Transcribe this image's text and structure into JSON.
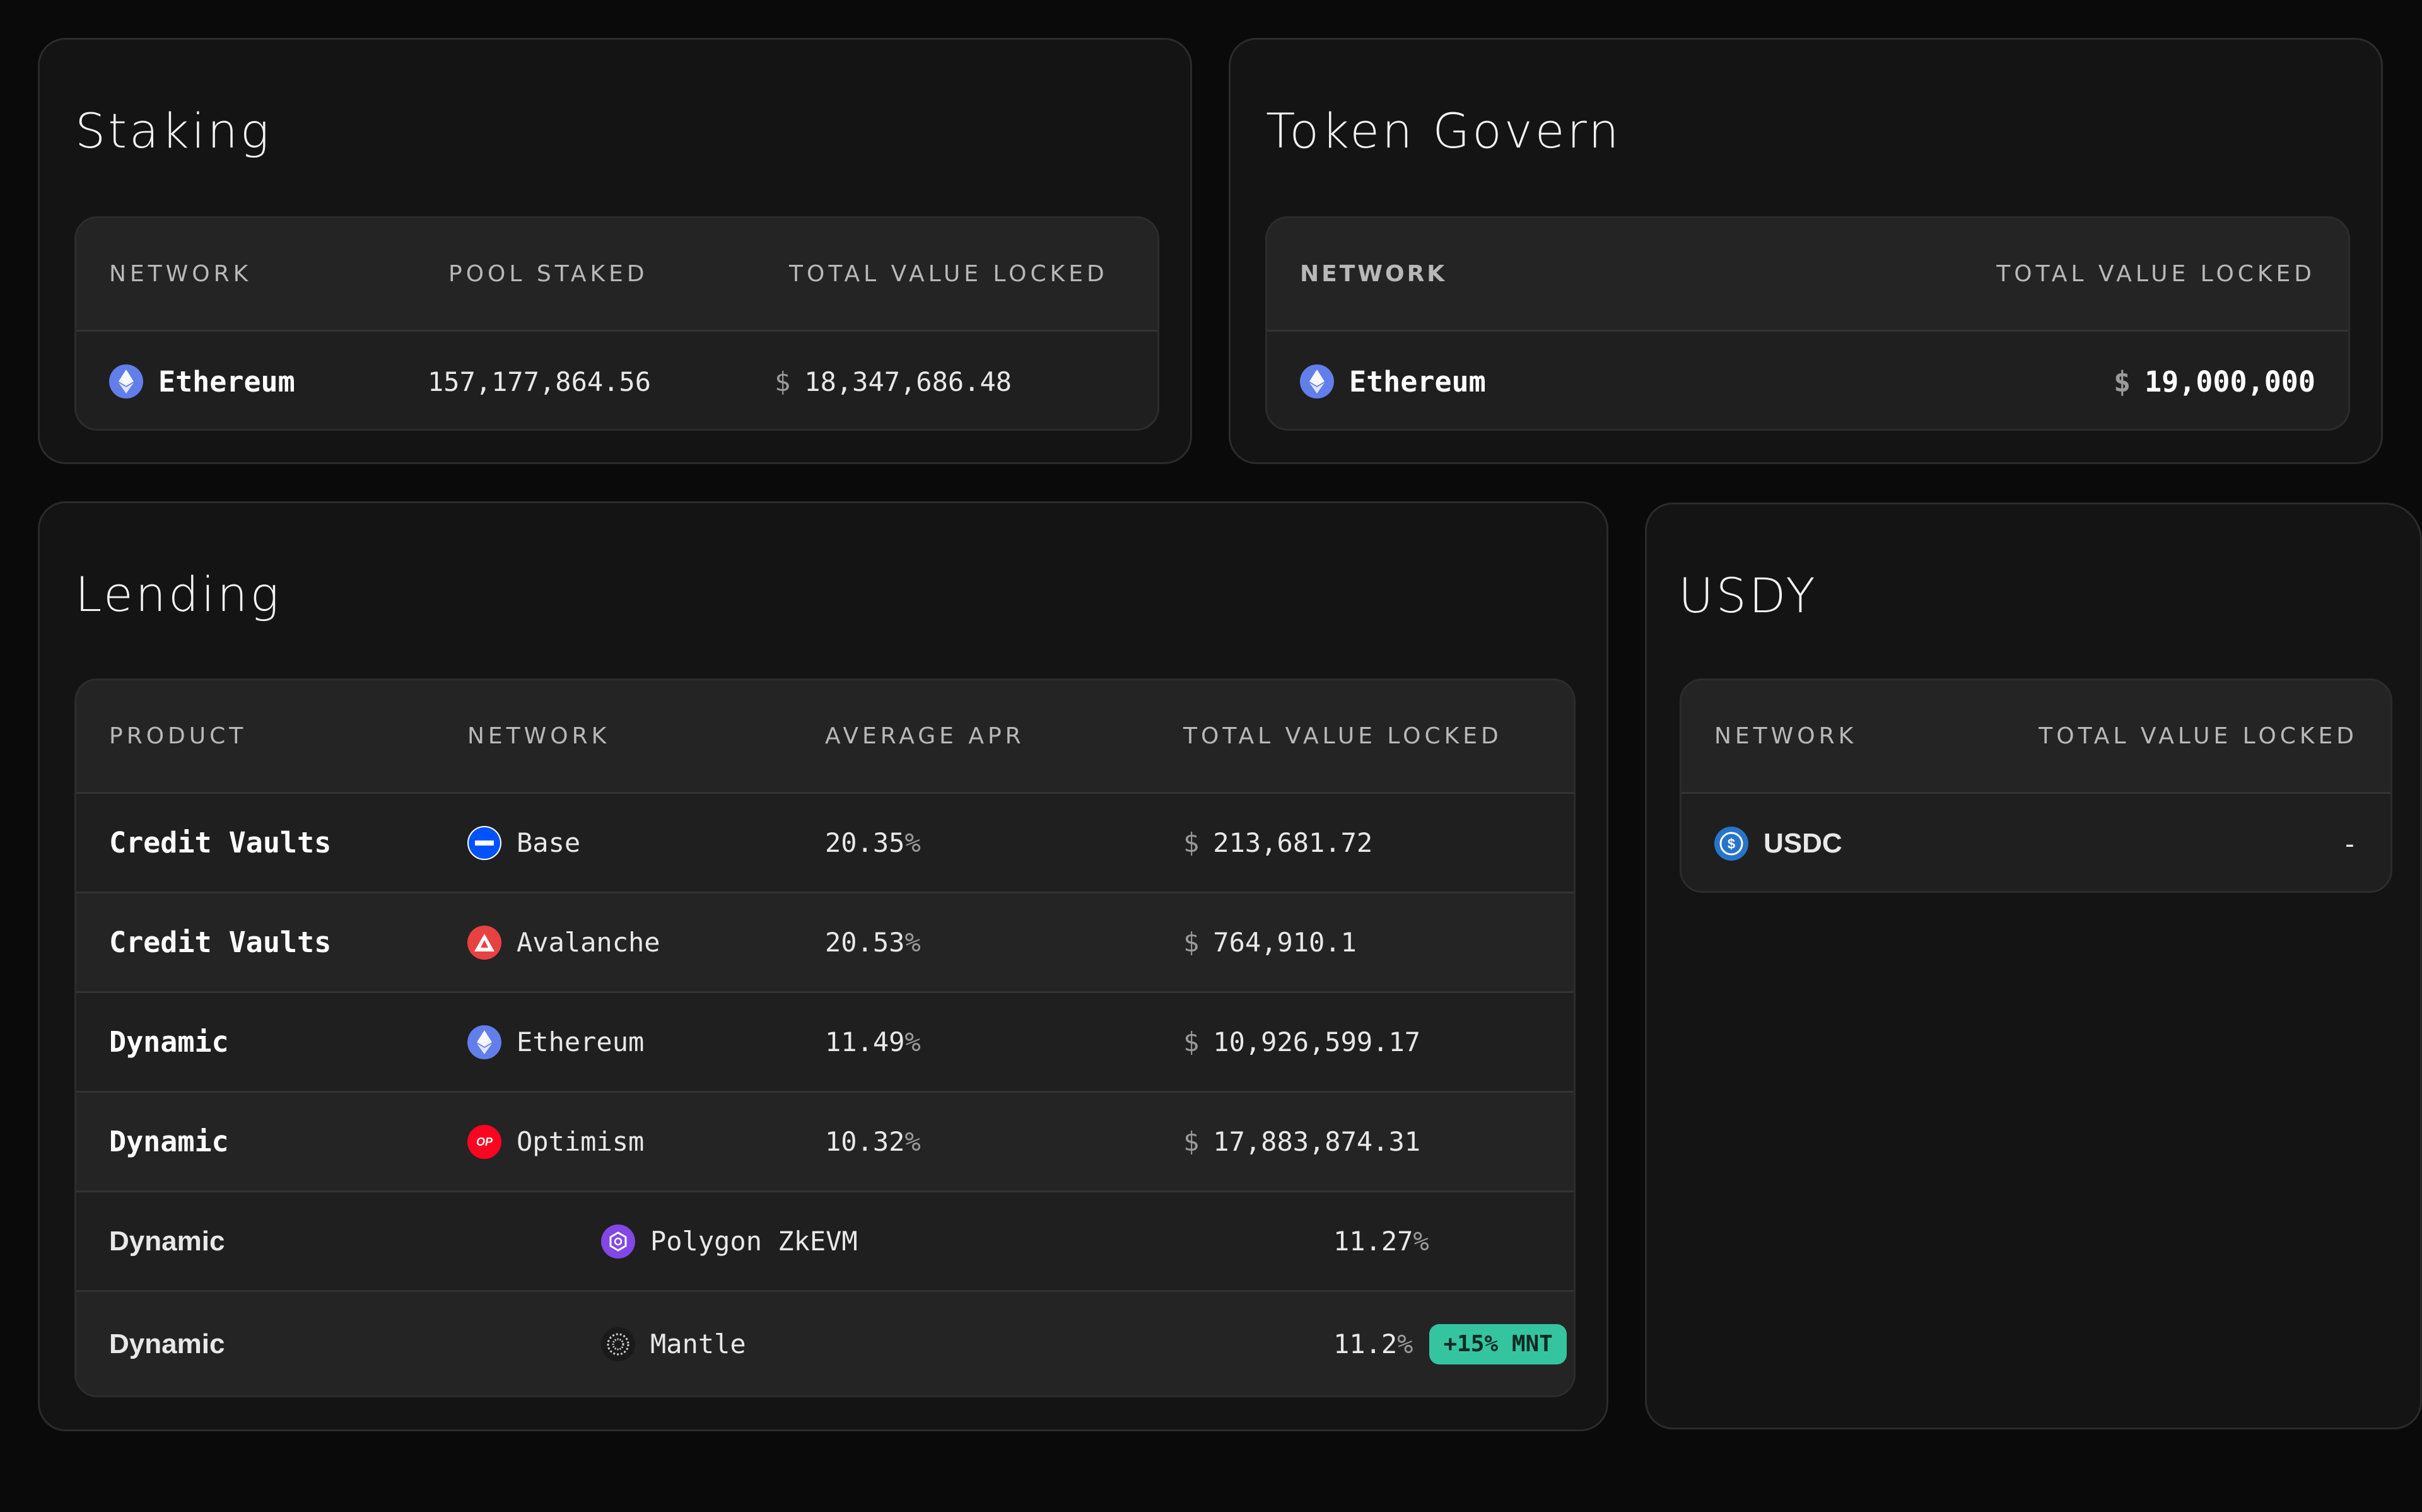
{
  "staking": {
    "title": "Staking",
    "headers": [
      "Network",
      "Pool Staked",
      "Total Value Locked"
    ],
    "row": {
      "network": "Ethereum",
      "network_icon": "ethereum-icon",
      "pool_staked": "157,177,864.56",
      "currency": "$",
      "tvl": "18,347,686.48"
    }
  },
  "governance": {
    "title": "Token Govern",
    "headers": [
      "NETWORK",
      "TOTAL VALUE LOCKED"
    ],
    "row": {
      "network": "Ethereum",
      "network_icon": "ethereum-icon",
      "currency": "$",
      "tvl": "19,000,000"
    }
  },
  "lending": {
    "title": "Lending",
    "headers": [
      "Product",
      "Network",
      "Average APR",
      "Total Value Locked"
    ],
    "rows": [
      {
        "product": "Credit Vaults",
        "network": "Base",
        "network_icon": "base-icon",
        "apr": "20.35",
        "pct": "%",
        "currency": "$",
        "tvl": "213,681.72"
      },
      {
        "product": "Credit Vaults",
        "network": "Avalanche",
        "network_icon": "avalanche-icon",
        "apr": "20.53",
        "pct": "%",
        "currency": "$",
        "tvl": "764,910.1"
      },
      {
        "product": "Dynamic",
        "network": "Ethereum",
        "network_icon": "ethereum-icon",
        "apr": "11.49",
        "pct": "%",
        "currency": "$",
        "tvl": "10,926,599.17"
      },
      {
        "product": "Dynamic",
        "network": "Optimism",
        "network_icon": "optimism-icon",
        "apr": "10.32",
        "pct": "%",
        "currency": "$",
        "tvl": "17,883,874.31"
      },
      {
        "product": "Dynamic",
        "network": "Polygon ZkEVM",
        "network_icon": "polygon-icon",
        "apr": "11.27",
        "pct": "%"
      },
      {
        "product": "Dynamic",
        "network": "Mantle",
        "network_icon": "mantle-icon",
        "apr": "11.2",
        "pct": "%",
        "badge": "+15% MNT"
      }
    ]
  },
  "usdy": {
    "title": "USDY",
    "headers": [
      "Network",
      "Total Value Locked"
    ],
    "row": {
      "network": "USDC",
      "network_icon": "usdc-icon",
      "tvl": "-"
    }
  },
  "colors": {
    "background": "#0a0a0a",
    "card": "#141414",
    "ethereum": "#627eea",
    "base": "#0052ff",
    "avalanche": "#e84142",
    "optimism": "#ff0420",
    "polygon": "#8247e5",
    "usdc": "#2775ca",
    "badge": "#35c4a0"
  }
}
